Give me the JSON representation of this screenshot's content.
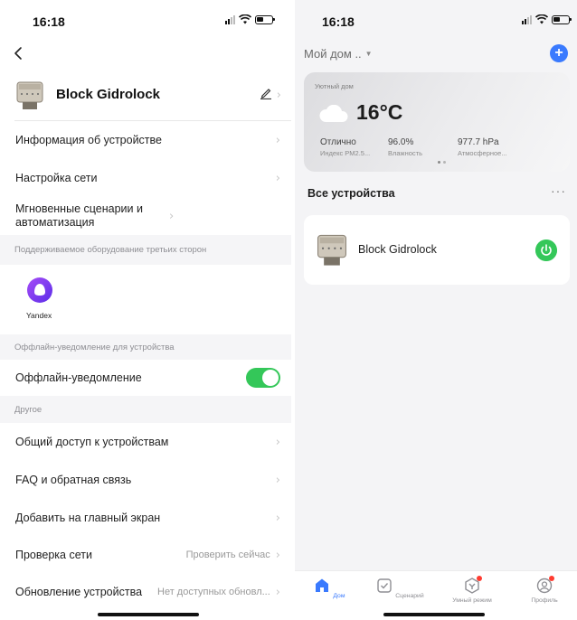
{
  "left": {
    "status_time": "16:18",
    "device_name": "Block Gidrolock",
    "rows_top": [
      {
        "label": "Информация об устройстве"
      },
      {
        "label": "Настройка сети"
      },
      {
        "label": "Мгновенные сценарии и автоматизация"
      }
    ],
    "section_third_party": "Поддерживаемое оборудование третьих сторон",
    "yandex_label": "Yandex",
    "section_offline": "Оффлайн-уведомление для устройства",
    "offline_label": "Оффлайн-уведомление",
    "offline_enabled": true,
    "section_other": "Другое",
    "rows_other": [
      {
        "label": "Общий доступ к устройствам",
        "value": ""
      },
      {
        "label": "FAQ и обратная связь",
        "value": ""
      },
      {
        "label": "Добавить на главный экран",
        "value": ""
      },
      {
        "label": "Проверка сети",
        "value": "Проверить сейчас"
      },
      {
        "label": "Обновление устройства",
        "value": "Нет доступных обновл..."
      }
    ]
  },
  "right": {
    "status_time": "16:18",
    "home_name": "Мой дом ..",
    "weather": {
      "location": "Уютный дом",
      "temperature": "16°C",
      "pm25_value": "Отлично",
      "pm25_label": "Индекс PM2.5...",
      "humidity_value": "96.0%",
      "humidity_label": "Влажность",
      "pressure_value": "977.7 hPa",
      "pressure_label": "Атмосферное..."
    },
    "all_devices_title": "Все устройства",
    "more": "···",
    "device_card_name": "Block Gidrolock",
    "tabs": [
      {
        "label": "Дом",
        "icon": "home-icon",
        "active": true
      },
      {
        "label": "Сценарий",
        "icon": "scene-check-icon",
        "active": false
      },
      {
        "label": "Умный режим",
        "icon": "smart-mode-icon",
        "active": false
      },
      {
        "label": "Профиль",
        "icon": "profile-icon",
        "active": false
      }
    ]
  },
  "colors": {
    "accent_blue": "#3a7afe",
    "toggle_green": "#34c759",
    "section_bg": "#f5f5f7",
    "alice_purple": "#7b3cf5"
  }
}
